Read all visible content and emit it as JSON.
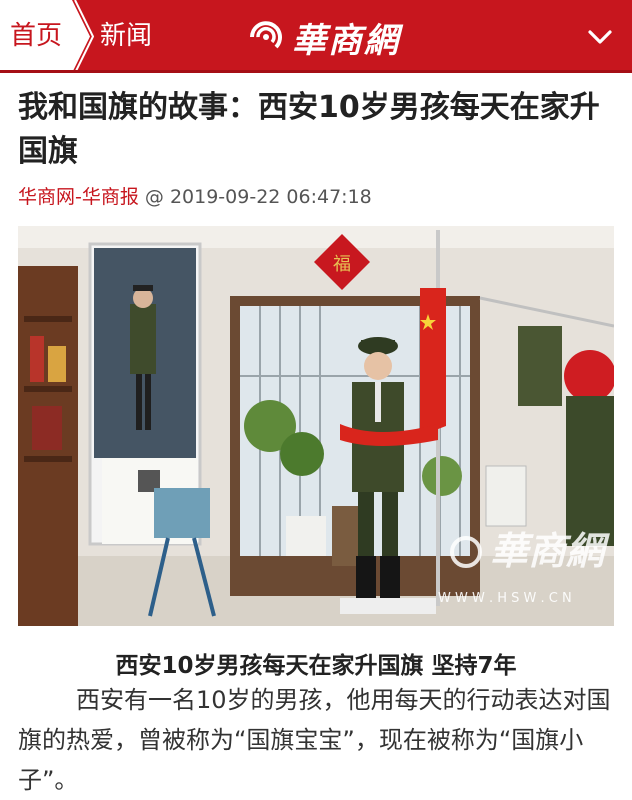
{
  "nav": {
    "home_label": "首页",
    "section_label": "新闻",
    "logo_text": "華商網",
    "menu_icon": "chevron-down-icon",
    "brand_color": "#c7161e"
  },
  "article": {
    "title": "我和国旗的故事：西安10岁男孩每天在家升国旗",
    "source": "华商网-华商报",
    "at": "@",
    "datetime": "2019-09-22 06:47:18",
    "photo_watermark_logo": "華商網",
    "photo_watermark_url": "W W W . H S W . C N",
    "subtitle": "西安10岁男孩每天在家升国旗 坚持7年",
    "paragraph": "西安有一名10岁的男孩，他用每天的行动表达对国旗的热爱，曾被称为“国旗宝宝”，现在被称为“国旗小子”。"
  }
}
